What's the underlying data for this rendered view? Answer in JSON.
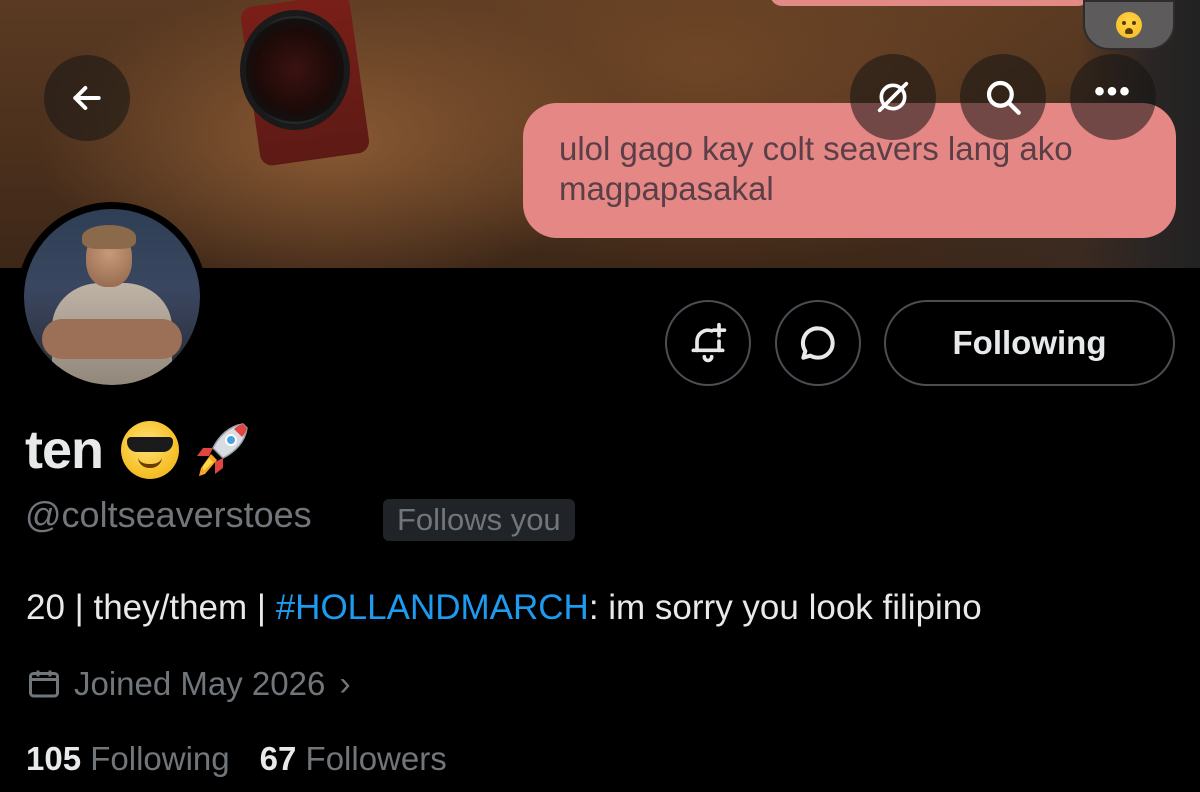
{
  "banner": {
    "dm_bubble_text": "ulol gago kay colt seavers lang ako magpapasakal",
    "reaction_icon": "crying-face-emoji"
  },
  "top_bar": {
    "back_icon": "arrow-left-icon",
    "grok_icon": "grok-icon",
    "search_icon": "search-icon",
    "more_icon": "more-dots-icon",
    "more_glyph": "•••"
  },
  "profile": {
    "display_name": "ten",
    "name_emojis": [
      "smiling-face-with-sunglasses",
      "rocket"
    ],
    "handle": "@coltseaverstoes",
    "follows_you_badge": "Follows you",
    "bio_prefix": "20 | they/them | ",
    "bio_hashtag": "#HOLLANDMARCH",
    "bio_suffix": ": im sorry you look filipino",
    "joined_text": "Joined May 2026",
    "joined_chevron": "›"
  },
  "actions": {
    "notify_icon": "bell-plus-icon",
    "message_icon": "message-bubble-icon",
    "following_label": "Following"
  },
  "stats": {
    "following_count": "105",
    "following_label": "Following",
    "followers_count": "67",
    "followers_label": "Followers"
  },
  "colors": {
    "background": "#000000",
    "accent_link": "#1d9bf0",
    "muted_text": "#71767b",
    "bubble": "#e58784"
  }
}
